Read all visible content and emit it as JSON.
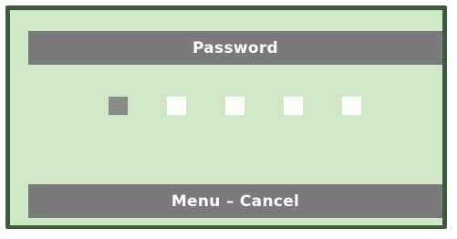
{
  "dialog": {
    "title": "Password",
    "footer_hint": "Menu – Cancel"
  },
  "password": {
    "length": 5,
    "active_index": 0
  },
  "colors": {
    "frame": "#3f5a3f",
    "panel": "#cfe8c6",
    "bar": "#7a7a7a",
    "digit_empty": "#ffffff",
    "digit_active": "#8a8a8a"
  }
}
